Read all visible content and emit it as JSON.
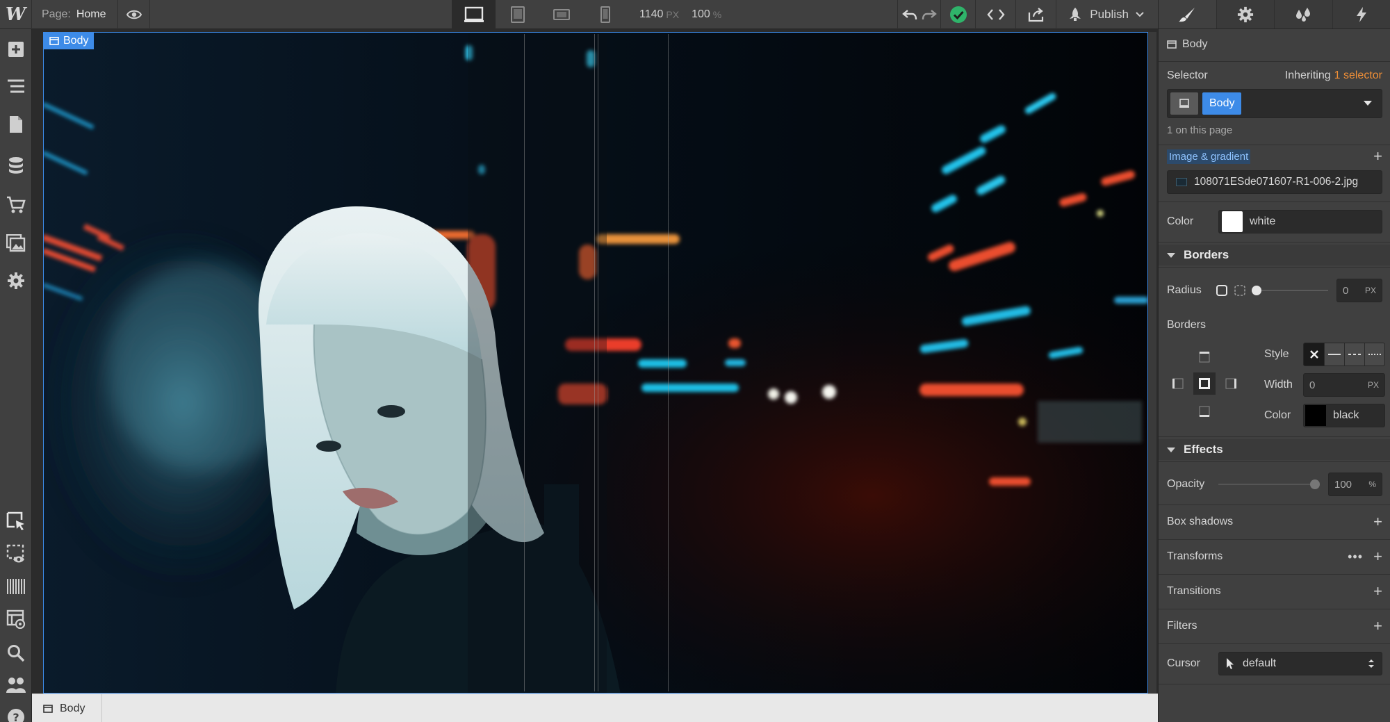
{
  "topbar": {
    "logo": "W",
    "page_label": "Page:",
    "page_name": "Home",
    "width_value": "1140",
    "width_unit": "PX",
    "zoom_value": "100",
    "zoom_unit": "%",
    "publish_label": "Publish",
    "icons": [
      "eye-icon",
      "desktop-icon",
      "tablet-icon",
      "mobile-landscape-icon",
      "mobile-portrait-icon",
      "undo-icon",
      "redo-icon",
      "check-icon",
      "code-icon",
      "export-icon",
      "rocket-icon"
    ]
  },
  "leftbar": {
    "icons": [
      "add-icon",
      "navigator-icon",
      "pages-icon",
      "cms-icon",
      "ecommerce-icon",
      "assets-icon",
      "settings-icon",
      "select-icon",
      "preview-icon",
      "grid-icon",
      "style-manager-icon",
      "search-icon",
      "team-icon",
      "help-icon"
    ]
  },
  "canvas": {
    "body_tag": "Body"
  },
  "breadcrumb": {
    "items": [
      "Body"
    ]
  },
  "panel": {
    "tabs": [
      "style-brush-icon",
      "settings-gear-icon",
      "interactions-drops-icon",
      "lightning-icon"
    ],
    "element_name": "Body",
    "selector_label": "Selector",
    "inheriting_prefix": "Inheriting",
    "inheriting_count": "1 selector",
    "selector_chip": "Body",
    "on_page": "1 on this page",
    "image_gradient_label": "Image & gradient",
    "image_file": "108071ESde071607-R1-006-2.jpg",
    "color_label": "Color",
    "color_value": "white",
    "borders_section": "Borders",
    "radius_label": "Radius",
    "radius_value": "0",
    "radius_unit": "PX",
    "borders_label": "Borders",
    "style_label": "Style",
    "width_label": "Width",
    "border_width_value": "0",
    "border_width_unit": "PX",
    "border_color_label": "Color",
    "border_color_value": "black",
    "effects_section": "Effects",
    "opacity_label": "Opacity",
    "opacity_value": "100",
    "opacity_unit": "%",
    "box_shadows_label": "Box shadows",
    "transforms_label": "Transforms",
    "transitions_label": "Transitions",
    "filters_label": "Filters",
    "cursor_label": "Cursor",
    "cursor_value": "default",
    "colors": {
      "accent": "#3d8be8",
      "orange": "#f08f37",
      "success": "#2fb36a"
    }
  }
}
